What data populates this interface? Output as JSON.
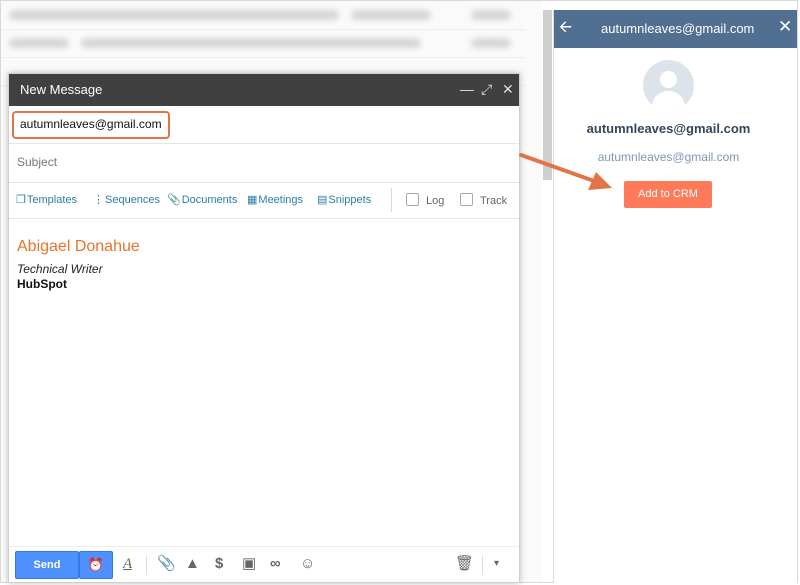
{
  "compose": {
    "title": "New Message",
    "to_value": "autumnleaves@gmail.com",
    "subject_placeholder": "Subject",
    "tools": {
      "templates": "Templates",
      "sequences": "Sequences",
      "documents": "Documents",
      "meetings": "Meetings",
      "snippets": "Snippets",
      "log": "Log",
      "track": "Track"
    },
    "signature": {
      "name": "Abigael Donahue",
      "role": "Technical Writer",
      "company": "HubSpot"
    },
    "send_label": "Send",
    "icons": [
      "minimize-icon",
      "expand-icon",
      "close-icon",
      "alarm-icon",
      "formatting-icon",
      "attach-icon",
      "drive-icon",
      "dollar-icon",
      "photo-icon",
      "link-icon",
      "emoji-icon",
      "trash-icon",
      "more-options-icon"
    ]
  },
  "panel": {
    "title": "autumnleaves@gmail.com",
    "contact_name": "autumnleaves@gmail.com",
    "contact_email": "autumnleaves@gmail.com",
    "add_to_crm_label": "Add to CRM",
    "icons": [
      "back-arrow-icon",
      "close-icon",
      "avatar-icon"
    ]
  },
  "colors": {
    "accent_orange": "#ff7a59",
    "panel_header": "#516f90",
    "compose_header": "#404040",
    "send_blue": "#4d90fe",
    "highlight_border": "#e27448",
    "signature_name": "#e8732a",
    "tool_link": "#2c7ea8"
  }
}
